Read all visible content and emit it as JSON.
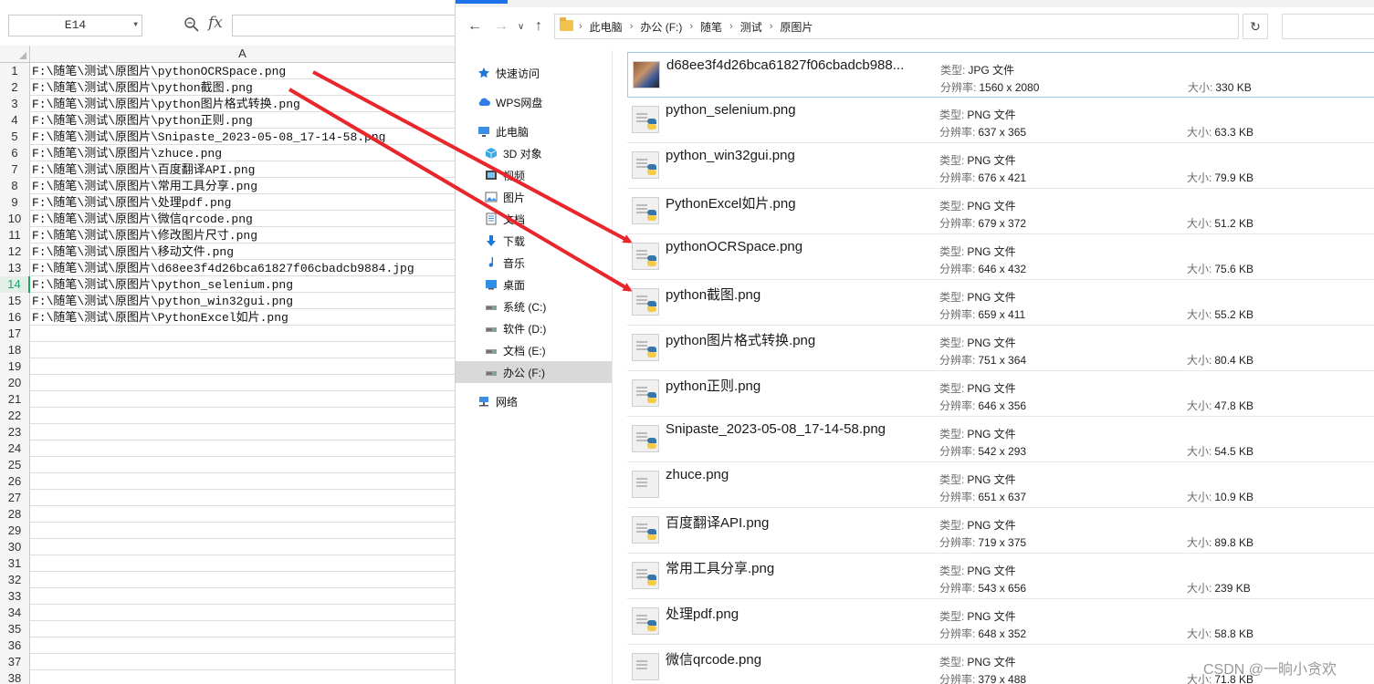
{
  "spreadsheet": {
    "name_box": "E14",
    "fx_label": "fx",
    "column_header": "A",
    "selected_row": "14",
    "rows": [
      {
        "num": "1",
        "text": "F:\\随笔\\测试\\原图片\\pythonOCRSpace.png"
      },
      {
        "num": "2",
        "text": "F:\\随笔\\测试\\原图片\\python截图.png"
      },
      {
        "num": "3",
        "text": "F:\\随笔\\测试\\原图片\\python图片格式转换.png"
      },
      {
        "num": "4",
        "text": "F:\\随笔\\测试\\原图片\\python正则.png"
      },
      {
        "num": "5",
        "text": "F:\\随笔\\测试\\原图片\\Snipaste_2023-05-08_17-14-58.png"
      },
      {
        "num": "6",
        "text": "F:\\随笔\\测试\\原图片\\zhuce.png"
      },
      {
        "num": "7",
        "text": "F:\\随笔\\测试\\原图片\\百度翻译API.png"
      },
      {
        "num": "8",
        "text": "F:\\随笔\\测试\\原图片\\常用工具分享.png"
      },
      {
        "num": "9",
        "text": "F:\\随笔\\测试\\原图片\\处理pdf.png"
      },
      {
        "num": "10",
        "text": "F:\\随笔\\测试\\原图片\\微信qrcode.png"
      },
      {
        "num": "11",
        "text": "F:\\随笔\\测试\\原图片\\修改图片尺寸.png"
      },
      {
        "num": "12",
        "text": "F:\\随笔\\测试\\原图片\\移动文件.png"
      },
      {
        "num": "13",
        "text": "F:\\随笔\\测试\\原图片\\d68ee3f4d26bca61827f06cbadcb9884.jpg"
      },
      {
        "num": "14",
        "text": "F:\\随笔\\测试\\原图片\\python_selenium.png"
      },
      {
        "num": "15",
        "text": "F:\\随笔\\测试\\原图片\\python_win32gui.png"
      },
      {
        "num": "16",
        "text": "F:\\随笔\\测试\\原图片\\PythonExcel如片.png"
      },
      {
        "num": "17",
        "text": ""
      },
      {
        "num": "18",
        "text": ""
      },
      {
        "num": "19",
        "text": ""
      },
      {
        "num": "20",
        "text": ""
      },
      {
        "num": "21",
        "text": ""
      },
      {
        "num": "22",
        "text": ""
      },
      {
        "num": "23",
        "text": ""
      },
      {
        "num": "24",
        "text": ""
      },
      {
        "num": "25",
        "text": ""
      },
      {
        "num": "26",
        "text": ""
      },
      {
        "num": "27",
        "text": ""
      },
      {
        "num": "28",
        "text": ""
      },
      {
        "num": "29",
        "text": ""
      },
      {
        "num": "30",
        "text": ""
      },
      {
        "num": "31",
        "text": ""
      },
      {
        "num": "32",
        "text": ""
      },
      {
        "num": "33",
        "text": ""
      },
      {
        "num": "34",
        "text": ""
      },
      {
        "num": "35",
        "text": ""
      },
      {
        "num": "36",
        "text": ""
      },
      {
        "num": "37",
        "text": ""
      },
      {
        "num": "38",
        "text": ""
      }
    ]
  },
  "explorer": {
    "breadcrumbs": [
      "此电脑",
      "办公 (F:)",
      "随笔",
      "测试",
      "原图片"
    ],
    "nav_items": [
      {
        "label": "快速访问",
        "icon": "star-icon",
        "indent": 1,
        "selected": false
      },
      {
        "label": "WPS网盘",
        "icon": "cloud-icon",
        "indent": 1,
        "selected": false
      },
      {
        "label": "此电脑",
        "icon": "computer-icon",
        "indent": 1,
        "selected": false
      },
      {
        "label": "3D 对象",
        "icon": "cube-icon",
        "indent": 2,
        "selected": false
      },
      {
        "label": "视频",
        "icon": "video-icon",
        "indent": 2,
        "selected": false
      },
      {
        "label": "图片",
        "icon": "picture-icon",
        "indent": 2,
        "selected": false
      },
      {
        "label": "文档",
        "icon": "document-icon",
        "indent": 2,
        "selected": false
      },
      {
        "label": "下载",
        "icon": "download-icon",
        "indent": 2,
        "selected": false
      },
      {
        "label": "音乐",
        "icon": "music-icon",
        "indent": 2,
        "selected": false
      },
      {
        "label": "桌面",
        "icon": "desktop-icon",
        "indent": 2,
        "selected": false
      },
      {
        "label": "系统 (C:)",
        "icon": "drive-icon",
        "indent": 2,
        "selected": false
      },
      {
        "label": "软件 (D:)",
        "icon": "drive-icon",
        "indent": 2,
        "selected": false
      },
      {
        "label": "文档 (E:)",
        "icon": "drive-icon",
        "indent": 2,
        "selected": false
      },
      {
        "label": "办公 (F:)",
        "icon": "drive-icon",
        "indent": 2,
        "selected": true
      },
      {
        "label": "网络",
        "icon": "network-icon",
        "indent": 1,
        "selected": false
      }
    ],
    "labels": {
      "type": "类型:",
      "resolution": "分辨率:",
      "size": "大小:"
    },
    "files": [
      {
        "name": "d68ee3f4d26bca61827f06cbadcb988...",
        "type": "JPG 文件",
        "resolution": "1560 x 2080",
        "size": "330 KB",
        "thumb": "photo"
      },
      {
        "name": "python_selenium.png",
        "type": "PNG 文件",
        "resolution": "637 x 365",
        "size": "63.3 KB",
        "thumb": "py"
      },
      {
        "name": "python_win32gui.png",
        "type": "PNG 文件",
        "resolution": "676 x 421",
        "size": "79.9 KB",
        "thumb": "py"
      },
      {
        "name": "PythonExcel如片.png",
        "type": "PNG 文件",
        "resolution": "679 x 372",
        "size": "51.2 KB",
        "thumb": "py"
      },
      {
        "name": "pythonOCRSpace.png",
        "type": "PNG 文件",
        "resolution": "646 x 432",
        "size": "75.6 KB",
        "thumb": "py"
      },
      {
        "name": "python截图.png",
        "type": "PNG 文件",
        "resolution": "659 x 411",
        "size": "55.2 KB",
        "thumb": "py"
      },
      {
        "name": "python图片格式转换.png",
        "type": "PNG 文件",
        "resolution": "751 x 364",
        "size": "80.4 KB",
        "thumb": "py"
      },
      {
        "name": "python正则.png",
        "type": "PNG 文件",
        "resolution": "646 x 356",
        "size": "47.8 KB",
        "thumb": "py"
      },
      {
        "name": "Snipaste_2023-05-08_17-14-58.png",
        "type": "PNG 文件",
        "resolution": "542 x 293",
        "size": "54.5 KB",
        "thumb": "py"
      },
      {
        "name": "zhuce.png",
        "type": "PNG 文件",
        "resolution": "651 x 637",
        "size": "10.9 KB",
        "thumb": "plain"
      },
      {
        "name": "百度翻译API.png",
        "type": "PNG 文件",
        "resolution": "719 x 375",
        "size": "89.8 KB",
        "thumb": "py"
      },
      {
        "name": "常用工具分享.png",
        "type": "PNG 文件",
        "resolution": "543 x 656",
        "size": "239 KB",
        "thumb": "py"
      },
      {
        "name": "处理pdf.png",
        "type": "PNG 文件",
        "resolution": "648 x 352",
        "size": "58.8 KB",
        "thumb": "py"
      },
      {
        "name": "微信qrcode.png",
        "type": "PNG 文件",
        "resolution": "379 x 488",
        "size": "71.8 KB",
        "thumb": "plain"
      }
    ]
  },
  "watermark": "CSDN @一晌小贪欢",
  "colors": {
    "arrow": "#e8262b",
    "selected_row": "#21a366",
    "nav_selected": "#d9d9d9",
    "accent": "#1a73e8"
  }
}
